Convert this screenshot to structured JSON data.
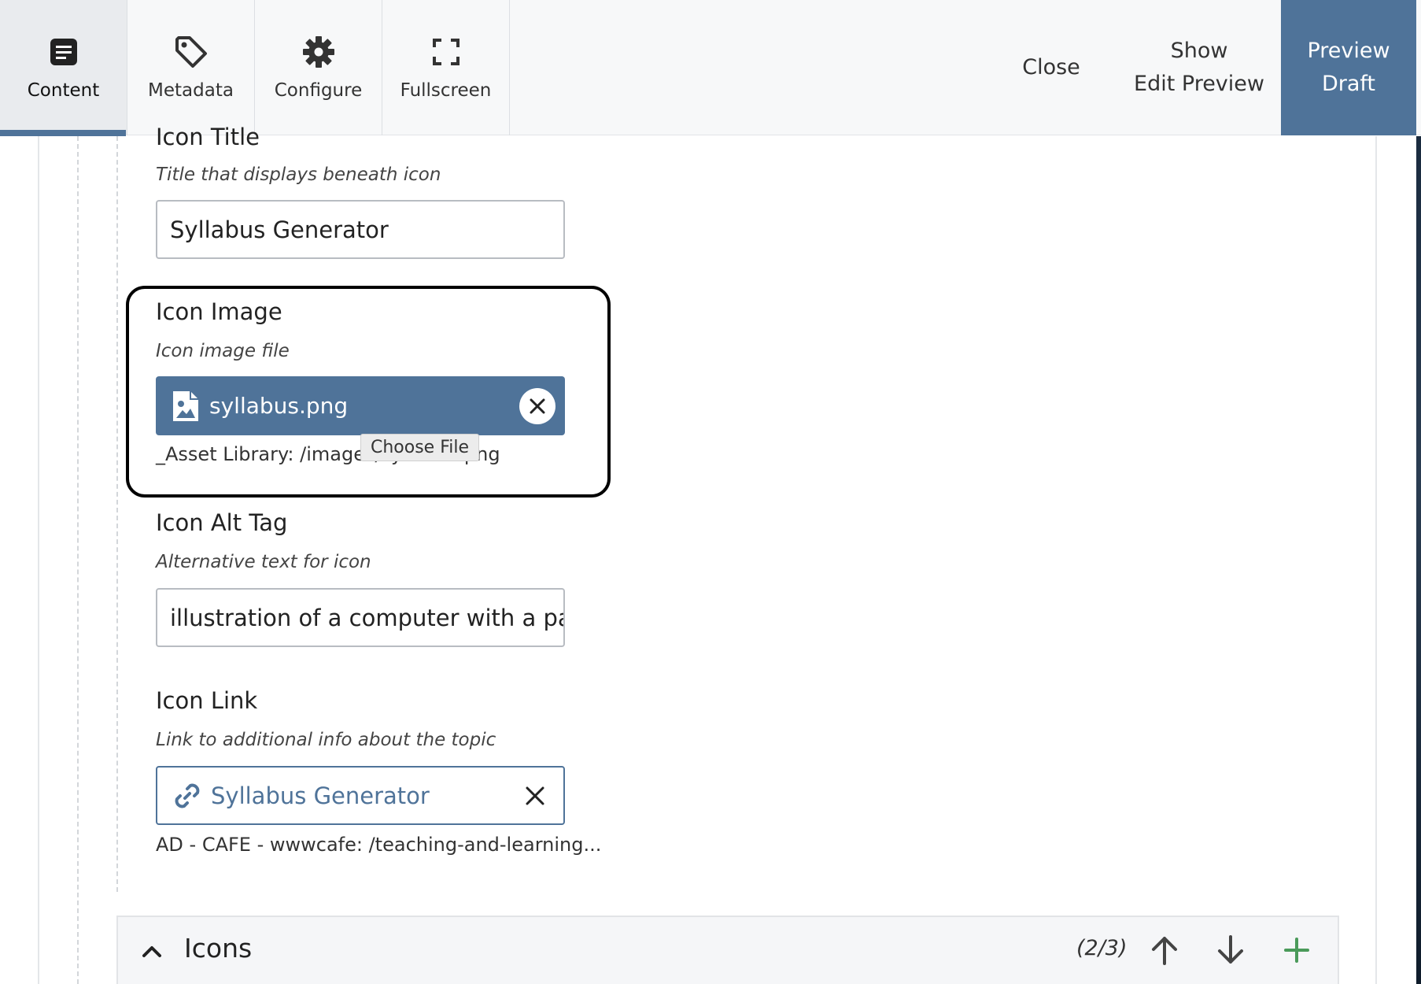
{
  "toolbar": {
    "tabs": [
      {
        "label": "Content",
        "icon": "document-icon",
        "active": true
      },
      {
        "label": "Metadata",
        "icon": "tag-icon"
      },
      {
        "label": "Configure",
        "icon": "gear-icon"
      },
      {
        "label": "Fullscreen",
        "icon": "fullscreen-icon"
      }
    ],
    "close_label": "Close",
    "show_edit_preview": [
      "Show",
      "Edit Preview"
    ],
    "preview_draft": [
      "Preview",
      "Draft"
    ]
  },
  "form": {
    "icon_title": {
      "label": "Icon Title",
      "hint": "Title that displays beneath icon",
      "value": "Syllabus Generator"
    },
    "icon_image": {
      "label": "Icon Image",
      "hint": "Icon image file",
      "file_name": "syllabus.png",
      "asset_path": "_Asset Library: /images/syllabus.png",
      "tooltip": "Choose File"
    },
    "icon_alt": {
      "label": "Icon Alt Tag",
      "hint": "Alternative text for icon",
      "value": "illustration of a computer with a paper"
    },
    "icon_link": {
      "label": "Icon Link",
      "hint": "Link to additional info about the topic",
      "value": "Syllabus Generator",
      "path": "AD - CAFE - wwwcafe: /teaching-and-learning..."
    }
  },
  "icons_section": {
    "title": "Icons",
    "counter": "(2/3)"
  },
  "colors": {
    "accent": "#4f7399",
    "add": "#4a9a5a"
  }
}
